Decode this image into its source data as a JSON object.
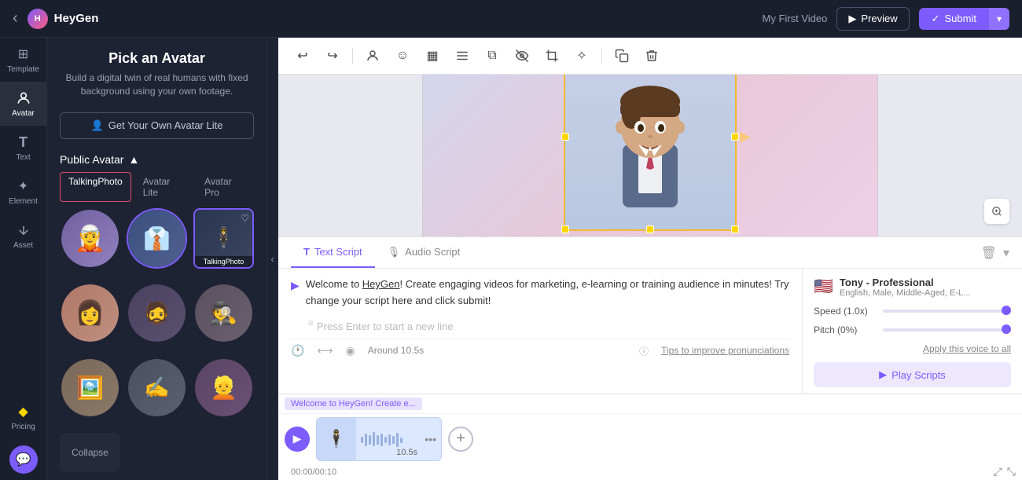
{
  "app": {
    "name": "HeyGen",
    "back_icon": "‹",
    "logo_icon": "H"
  },
  "nav": {
    "project_label": "My First Video",
    "preview_label": "Preview",
    "submit_label": "Submit"
  },
  "sidebar": {
    "items": [
      {
        "id": "template",
        "label": "Template",
        "icon": "⊞"
      },
      {
        "id": "avatar",
        "label": "Avatar",
        "icon": "👤"
      },
      {
        "id": "text",
        "label": "Text",
        "icon": "T"
      },
      {
        "id": "element",
        "label": "Element",
        "icon": "✦"
      },
      {
        "id": "asset",
        "label": "Asset",
        "icon": "↓"
      },
      {
        "id": "pricing",
        "label": "Pricing",
        "icon": "◆"
      }
    ]
  },
  "avatar_panel": {
    "title": "Pick an Avatar",
    "subtitle": "Build a digital twin of real humans with fixed background using your own footage.",
    "get_avatar_btn": "Get Your Own Avatar Lite",
    "public_label": "Public Avatar",
    "tabs": [
      "TalkingPhoto",
      "Avatar Lite",
      "Avatar Pro"
    ],
    "active_tab": "TalkingPhoto",
    "collapse_label": "Collapse",
    "avatars": [
      {
        "id": 1,
        "color": "#7c6cb8",
        "emoji": "🧝",
        "label": ""
      },
      {
        "id": 2,
        "color": "#3a5080",
        "emoji": "👔",
        "label": "",
        "selected": true
      },
      {
        "id": 3,
        "color": "#2a3550",
        "emoji": "👤",
        "label": "TalkingPhoto",
        "is_talking": true,
        "selected": true
      },
      {
        "id": 4,
        "color": "#b07870",
        "emoji": "👩",
        "label": ""
      },
      {
        "id": 5,
        "color": "#4a4060",
        "emoji": "🧑",
        "label": ""
      },
      {
        "id": 6,
        "color": "#5a4858",
        "emoji": "👓",
        "label": ""
      },
      {
        "id": 7,
        "color": "#8a7870",
        "emoji": "🖼️",
        "label": ""
      },
      {
        "id": 8,
        "color": "#4a5070",
        "emoji": "✒️",
        "label": ""
      },
      {
        "id": 9,
        "color": "#5a4065",
        "emoji": "👱",
        "label": ""
      }
    ]
  },
  "toolbar": {
    "buttons": [
      {
        "id": "undo",
        "icon": "↩",
        "label": "Undo"
      },
      {
        "id": "redo",
        "icon": "↪",
        "label": "Redo"
      },
      {
        "id": "person",
        "icon": "🧑",
        "label": "Person"
      },
      {
        "id": "emoji",
        "icon": "😊",
        "label": "Emoji"
      },
      {
        "id": "grid",
        "icon": "▦",
        "label": "Grid"
      },
      {
        "id": "align",
        "icon": "☰",
        "label": "Align"
      },
      {
        "id": "layers",
        "icon": "⧉",
        "label": "Layers"
      },
      {
        "id": "hide",
        "icon": "⊘",
        "label": "Hide"
      },
      {
        "id": "crop",
        "icon": "⊕",
        "label": "Crop"
      },
      {
        "id": "effects",
        "icon": "✧",
        "label": "Effects"
      },
      {
        "id": "copy",
        "icon": "⧉",
        "label": "Copy"
      },
      {
        "id": "delete",
        "icon": "🗑",
        "label": "Delete"
      }
    ]
  },
  "canvas": {
    "zoom_icon": "🔍"
  },
  "script": {
    "tabs": [
      {
        "id": "text",
        "label": "Text Script",
        "icon": "T"
      },
      {
        "id": "audio",
        "label": "Audio Script",
        "icon": "🎙"
      }
    ],
    "active_tab": "text",
    "content": "Welcome to HeyGen! Create engaging videos for marketing, e-learning or training audience in minutes! Try change your script here and click submit!",
    "heygen_link": "HeyGen",
    "placeholder": "Press Enter to start a new line",
    "apply_voice_label": "Apply this voice to all",
    "around_label": "Around 10.5s",
    "tips_label": "Tips to improve pronunciations"
  },
  "voice": {
    "flag": "🇺🇸",
    "name": "Tony - Professional",
    "description": "English, Male, Middle-Aged, E-L...",
    "speed_label": "Speed (1.0x)",
    "pitch_label": "Pitch (0%)",
    "play_label": "Play Scripts"
  },
  "timeline": {
    "segment_label": "Welcome to HeyGen! Create e...",
    "time_display": "00:00/00:10",
    "clip_duration": "10.5s",
    "add_clip_icon": "+"
  }
}
